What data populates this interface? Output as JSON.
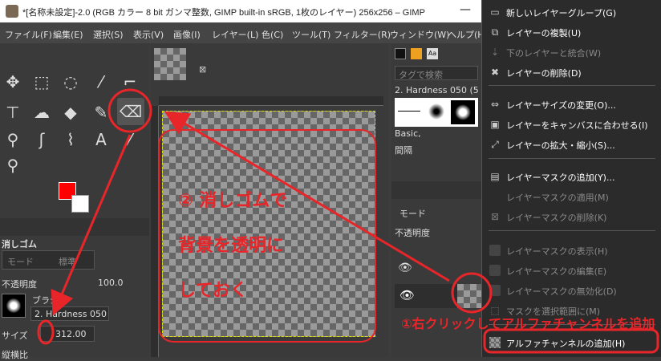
{
  "window": {
    "title": "*[名称未設定]-2.0 (RGB カラー 8 bit ガンマ整数, GIMP built-in sRGB, 1枚のレイヤー) 256x256 – GIMP",
    "controls": [
      "—",
      "□"
    ]
  },
  "menubar": [
    "ファイル(F)",
    "編集(E)",
    "選択(S)",
    "表示(V)",
    "画像(I)",
    "レイヤー(L)",
    "色(C)",
    "ツール(T)",
    "フィルター(R)",
    "ウィンドウ(W)",
    "ヘルプ(H)"
  ],
  "tool_options": {
    "tool_name": "消しゴム",
    "mode_label": "モード",
    "mode_value": "標準",
    "opacity_label": "不透明度",
    "opacity_value": "100.0",
    "brush_label": "ブラシ",
    "brush_value": "2. Hardness 050",
    "size_label": "サイズ",
    "size_value": "312.00",
    "aspect_label": "縦横比"
  },
  "right_panel": {
    "tag_placeholder": "タグで検索",
    "brush_name": "2. Hardness 050 (5",
    "preset": "Basic,",
    "spacing_label": "間隔",
    "layers_mode_label": "モード",
    "layers_opacity_label": "不透明度"
  },
  "context_menu": {
    "items": [
      {
        "label": "新しいレイヤーグループ(G)",
        "enabled": true,
        "icon": "folder-icon"
      },
      {
        "label": "レイヤーの複製(U)",
        "enabled": true,
        "icon": "duplicate-icon"
      },
      {
        "label": "下のレイヤーと統合(W)",
        "enabled": false,
        "icon": "merge-down-icon"
      },
      {
        "label": "レイヤーの削除(D)",
        "enabled": true,
        "icon": "delete-icon"
      },
      {
        "label": "レイヤーサイズの変更(O)...",
        "enabled": true,
        "icon": "resize-icon"
      },
      {
        "label": "レイヤーをキャンバスに合わせる(I)",
        "enabled": true,
        "icon": "fit-canvas-icon"
      },
      {
        "label": "レイヤーの拡大・縮小(S)...",
        "enabled": true,
        "icon": "scale-icon"
      },
      {
        "label": "レイヤーマスクの追加(Y)...",
        "enabled": true,
        "icon": "add-mask-icon"
      },
      {
        "label": "レイヤーマスクの適用(M)",
        "enabled": false,
        "icon": ""
      },
      {
        "label": "レイヤーマスクの削除(K)",
        "enabled": false,
        "icon": "delete-mask-icon"
      },
      {
        "label": "レイヤーマスクの表示(H)",
        "enabled": false,
        "icon": "checkbox-icon"
      },
      {
        "label": "レイヤーマスクの編集(E)",
        "enabled": false,
        "icon": "checkbox-icon"
      },
      {
        "label": "レイヤーマスクの無効化(D)",
        "enabled": false,
        "icon": "checkbox-icon"
      },
      {
        "label": "マスクを選択範囲に(M)",
        "enabled": false,
        "icon": "mask-to-selection-icon"
      },
      {
        "label": "アルファチャンネルの追加(H)",
        "enabled": true,
        "icon": "alpha-icon"
      }
    ]
  },
  "annotations": {
    "step2_line1": "② 消しゴムで",
    "step2_line2": "背景を透明に",
    "step2_line3": "しておく",
    "step1": "①右クリックしてアルファチャンネルを追加",
    "color": "#e8262a"
  }
}
